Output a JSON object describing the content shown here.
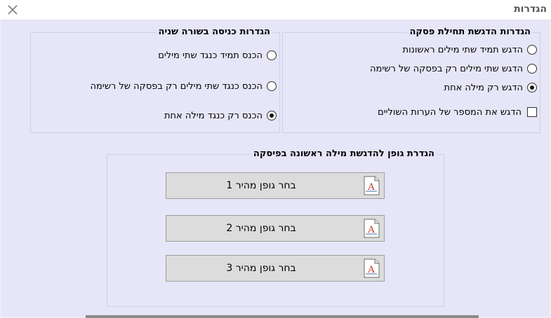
{
  "window": {
    "title": "הגדרות"
  },
  "highlight_group": {
    "title": "הגדרות הדגשת תחילת פסקה",
    "options": [
      {
        "label": "הדגש תמיד שתי מילים ראשונות",
        "selected": false
      },
      {
        "label": "הדגש שתי מילים רק בפסקה של רשימה",
        "selected": false
      },
      {
        "label": "הדגש רק מילה אחת",
        "selected": true
      }
    ],
    "footnote_checkbox": {
      "label": "הדגש את המספר של הערות השוליים",
      "checked": false
    }
  },
  "indent_group": {
    "title": "הגדרות כניסה בשורה שניה",
    "options": [
      {
        "label": "הכנס תמיד כנגד שתי מילים",
        "selected": false
      },
      {
        "label": "הכנס כנגד שתי מילים רק בפסקה של רשימה",
        "selected": false
      },
      {
        "label": "הכנס רק כנגד מילה אחת",
        "selected": true
      }
    ]
  },
  "font_group": {
    "title": "הגדרת גופן להדגשת מילה ראשונה בפיסקה",
    "buttons": [
      {
        "label": "בחר גופן מהיר 1",
        "icon": "font-file-icon"
      },
      {
        "label": "בחר גופן מהיר 2",
        "icon": "font-file-icon"
      },
      {
        "label": "בחר גופן מהיר 3",
        "icon": "font-file-icon"
      }
    ]
  },
  "colors": {
    "background": "#e6e6f8",
    "border": "#cfd0e4",
    "button": "#dcdcdc"
  }
}
